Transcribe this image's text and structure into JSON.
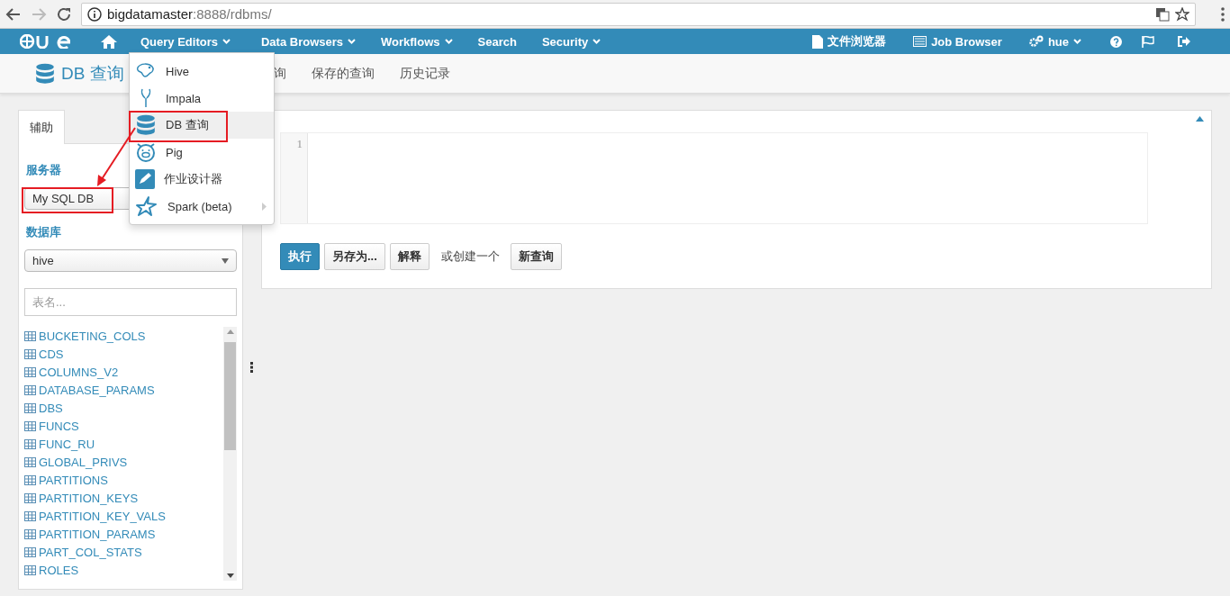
{
  "browser": {
    "url_host": "bigdatamaster",
    "url_path": ":8888/rdbms/"
  },
  "nav": {
    "items": [
      {
        "label": "Query Editors",
        "dropdown": true,
        "open": true
      },
      {
        "label": "Data Browsers",
        "dropdown": true,
        "open": false
      },
      {
        "label": "Workflows",
        "dropdown": true,
        "open": false
      },
      {
        "label": "Search",
        "dropdown": false,
        "open": false
      },
      {
        "label": "Security",
        "dropdown": true,
        "open": false
      }
    ],
    "right_items": [
      {
        "label": "文件浏览器",
        "kind": "file",
        "dropdown": false
      },
      {
        "label": "Job Browser",
        "kind": "list",
        "dropdown": false
      },
      {
        "label": "hue",
        "kind": "gears",
        "dropdown": true
      }
    ]
  },
  "subnav": {
    "title": "DB 查询",
    "tabs": [
      {
        "label": "询"
      },
      {
        "label": "保存的查询"
      },
      {
        "label": "历史记录"
      }
    ]
  },
  "dropdown": {
    "items": [
      {
        "label": "Hive",
        "kind": "hive",
        "selected": false,
        "submenu": false
      },
      {
        "label": "Impala",
        "kind": "impala",
        "selected": false,
        "submenu": false
      },
      {
        "label": "DB 查询",
        "kind": "db",
        "selected": true,
        "submenu": false
      },
      {
        "label": "Pig",
        "kind": "pig",
        "selected": false,
        "submenu": false
      },
      {
        "label": "作业设计器",
        "kind": "designer",
        "selected": false,
        "submenu": false
      },
      {
        "label": "Spark (beta)",
        "kind": "spark",
        "selected": false,
        "submenu": true
      }
    ]
  },
  "sidebar": {
    "tabs": [
      {
        "label": "辅助",
        "selected": true
      }
    ],
    "server_label": "服务器",
    "server": "My SQL DB",
    "database_label": "数据库",
    "database": "hive",
    "search": {
      "placeholder": "表名..."
    },
    "tables": [
      "BUCKETING_COLS",
      "CDS",
      "COLUMNS_V2",
      "DATABASE_PARAMS",
      "DBS",
      "FUNCS",
      "FUNC_RU",
      "GLOBAL_PRIVS",
      "PARTITIONS",
      "PARTITION_KEYS",
      "PARTITION_KEY_VALS",
      "PARTITION_PARAMS",
      "PART_COL_STATS",
      "ROLES"
    ]
  },
  "editor": {
    "line_numbers": [
      "1"
    ]
  },
  "actions": [
    {
      "label": "执行",
      "kind": "primary"
    },
    {
      "label": "另存为...",
      "kind": "default"
    },
    {
      "label": "解释",
      "kind": "default"
    },
    {
      "label": "或创建一个",
      "kind": "text"
    },
    {
      "label": "新查询",
      "kind": "default"
    }
  ]
}
